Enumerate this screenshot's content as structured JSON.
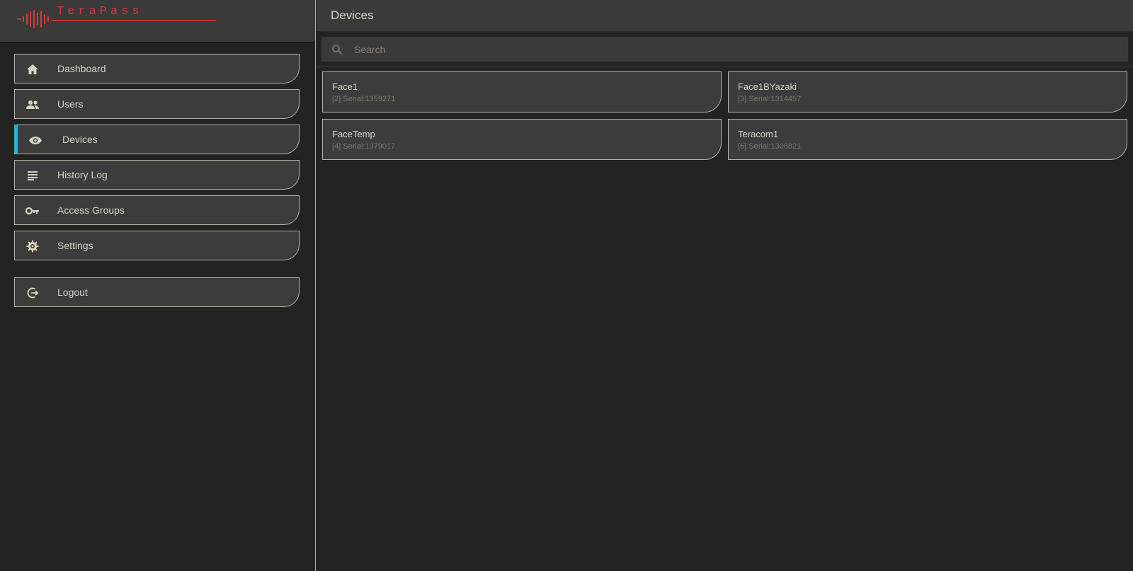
{
  "brand": {
    "name": "TeraPass",
    "accent_color": "#d63a3a"
  },
  "sidebar": {
    "items": [
      {
        "label": "Dashboard",
        "icon": "home-icon"
      },
      {
        "label": "Users",
        "icon": "users-icon"
      },
      {
        "label": "Devices",
        "icon": "eye-icon",
        "active": true
      },
      {
        "label": "History Log",
        "icon": "list-icon"
      },
      {
        "label": "Access Groups",
        "icon": "key-icon"
      },
      {
        "label": "Settings",
        "icon": "gear-icon"
      }
    ],
    "logout": {
      "label": "Logout",
      "icon": "logout-icon"
    },
    "active_color": "#1fb8d4"
  },
  "header": {
    "title": "Devices"
  },
  "search": {
    "placeholder": "Search",
    "value": ""
  },
  "devices": [
    {
      "name": "Face1",
      "serial": "[2] Serial:1359271"
    },
    {
      "name": "Face1BYazaki",
      "serial": "[3] Serial:1314457"
    },
    {
      "name": "FaceTemp",
      "serial": "[4] Serial:1379017"
    },
    {
      "name": "Teracom1",
      "serial": "[6] Serial:1306821"
    }
  ]
}
